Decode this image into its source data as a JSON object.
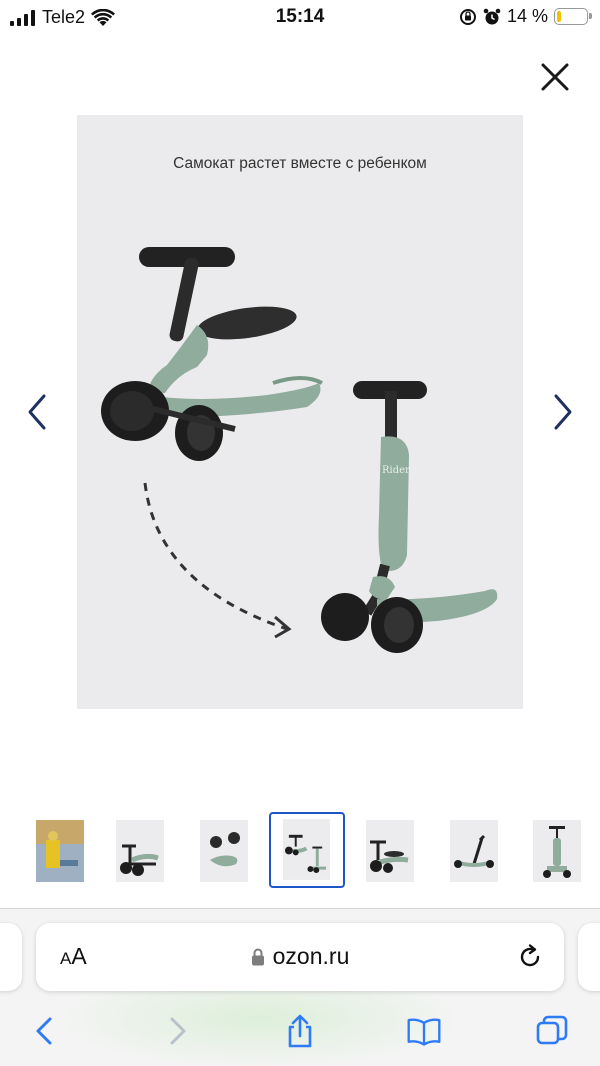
{
  "status_bar": {
    "carrier": "Tele2",
    "time": "15:14",
    "battery_percent": "14 %",
    "battery_level": 0.14,
    "icons": [
      "signal-icon",
      "wifi-icon",
      "orientation-lock-icon",
      "alarm-icon",
      "battery-icon"
    ]
  },
  "viewer": {
    "close_icon": "close-icon",
    "image_caption": "Самокат растет вместе с ребенком",
    "prev_icon": "chevron-left-icon",
    "next_icon": "chevron-right-icon"
  },
  "thumbnails": {
    "count": 7,
    "active_index": 3
  },
  "browser": {
    "text_size_label_small": "A",
    "text_size_label_large": "A",
    "url": "ozon.ru",
    "lock_icon": "lock-icon",
    "reload_icon": "reload-icon",
    "toolbar": [
      "back-icon",
      "forward-icon",
      "share-icon",
      "bookmarks-icon",
      "tabs-icon"
    ]
  },
  "colors": {
    "accent": "#1e56c9",
    "toolbar_blue": "#2f7bf6",
    "scooter_green": "#8fac9c",
    "battery_yellow": "#f2c200"
  }
}
